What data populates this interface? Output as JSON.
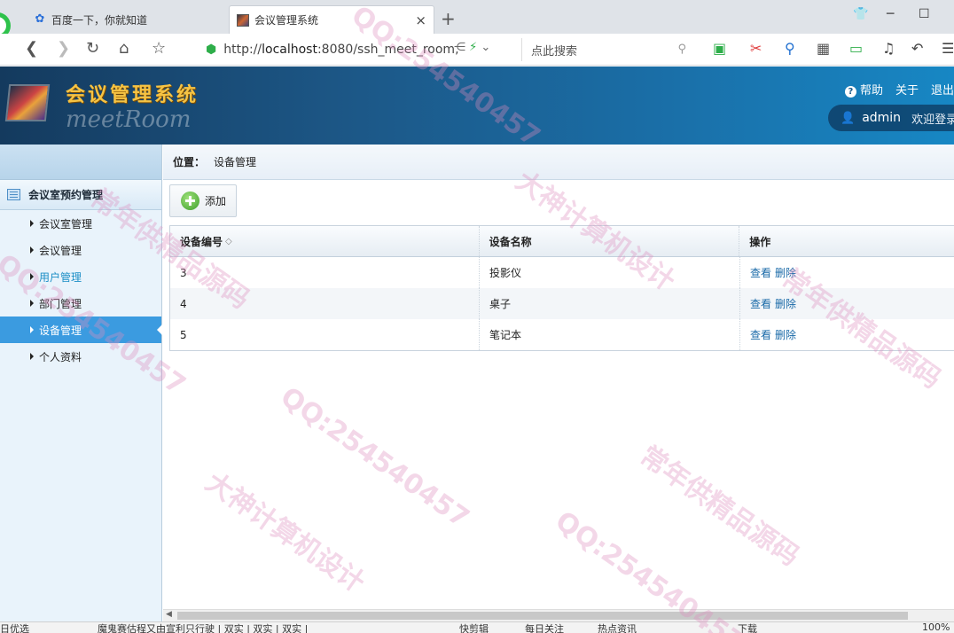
{
  "browser": {
    "tabs": [
      {
        "label": "百度一下，你就知道",
        "icon": "paw-icon"
      },
      {
        "label": "会议管理系统",
        "icon": "app-favicon",
        "close": "×"
      }
    ],
    "new_tab": "+",
    "url_prefix": "http://",
    "url_host": "localhost",
    "url_rest": ":8080/ssh_meet_room,",
    "search_placeholder": "点此搜索"
  },
  "header": {
    "title": "会议管理系统",
    "subtitle": "meetRoom",
    "links": [
      "帮助",
      "关于",
      "退出"
    ],
    "username": "admin",
    "welcome": "欢迎登录"
  },
  "sidebar": {
    "group_label": "会议室预约管理",
    "items": [
      {
        "label": "会议室管理",
        "state": "normal"
      },
      {
        "label": "会议管理",
        "state": "normal"
      },
      {
        "label": "用户管理",
        "state": "hover"
      },
      {
        "label": "部门管理",
        "state": "normal"
      },
      {
        "label": "设备管理",
        "state": "active"
      },
      {
        "label": "个人资料",
        "state": "normal"
      }
    ]
  },
  "breadcrumb": {
    "key": "位置：",
    "value": "设备管理"
  },
  "toolbar": {
    "add_label": "添加"
  },
  "table": {
    "columns": [
      "设备编号",
      "设备名称",
      "操作"
    ],
    "sort_glyph": "◇",
    "view_label": "查看",
    "delete_label": "删除",
    "rows": [
      {
        "id": "3",
        "name": "投影仪"
      },
      {
        "id": "4",
        "name": "桌子"
      },
      {
        "id": "5",
        "name": "笔记本"
      }
    ]
  },
  "statusbar": {
    "left": "日优选",
    "news": "魔鬼赛估程又由宣利只行驶 | 双实 | 双实 | 双实 |",
    "items": [
      "快剪辑",
      "每日关注",
      "热点资讯",
      "下载",
      "100%"
    ]
  },
  "watermarks": [
    "QQ:254540457",
    "大神计算机设计",
    "常年供精品源码"
  ]
}
